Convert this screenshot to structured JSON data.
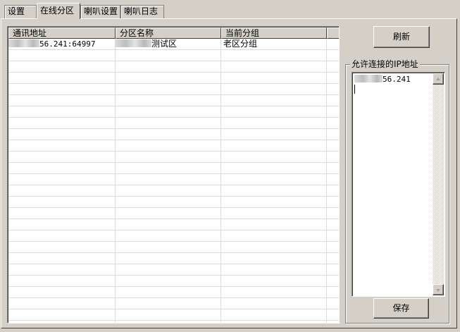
{
  "tabs": [
    "设置",
    "在线分区",
    "喇叭设置",
    "喇叭日志"
  ],
  "active_tab": "在线分区",
  "table": {
    "columns": [
      "通讯地址",
      "分区名称",
      "当前分组"
    ],
    "rows": [
      {
        "address": "56.241:64997",
        "zone": "测试区",
        "group": "老区分组"
      }
    ]
  },
  "buttons": {
    "refresh": "刷新",
    "save": "保存"
  },
  "allowed_ips": {
    "label": "允许连接的IP地址",
    "entries": [
      "56.241"
    ]
  }
}
